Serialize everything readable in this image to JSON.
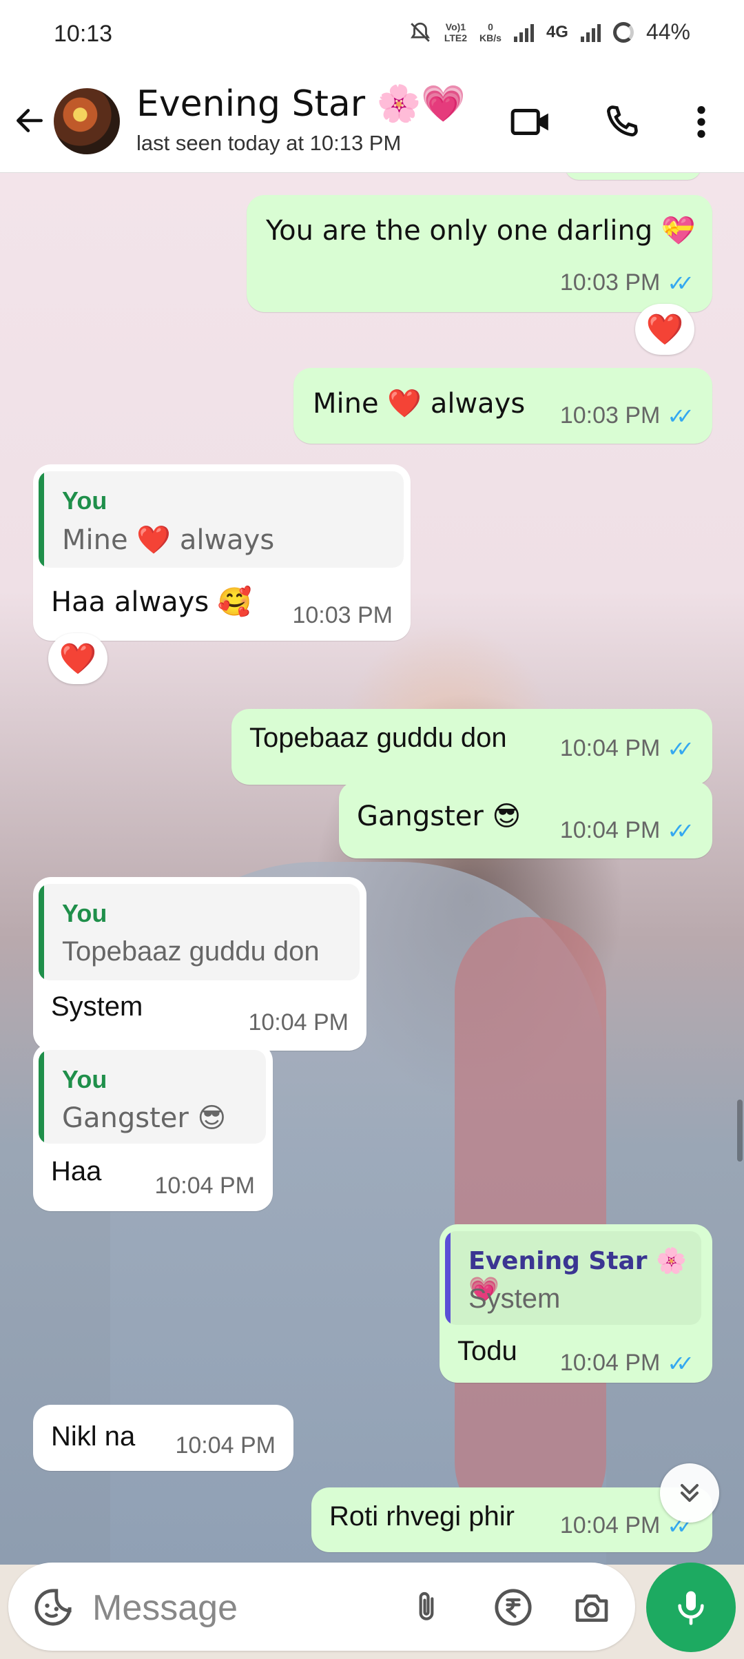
{
  "status_bar": {
    "time": "10:13",
    "volte": "Vo)1\nLTE2",
    "speed": "0\nKB/s",
    "network": "4G",
    "battery": "44%"
  },
  "header": {
    "contact_name": "Evening Star 🌸💗",
    "last_seen": "last seen today at 10:13 PM"
  },
  "messages": [
    {
      "text": "You are the only one darling 💝",
      "time": "10:03 PM",
      "reaction": "❤️"
    },
    {
      "text": "Mine ❤️ always",
      "time": "10:03 PM"
    },
    {
      "quote_author": "You",
      "quote_text": "Mine ❤️ always",
      "text": "Haa always 🥰",
      "time": "10:03 PM",
      "reaction": "❤️"
    },
    {
      "text": "Topebaaz guddu don",
      "time": "10:04 PM"
    },
    {
      "text": "Gangster 😎",
      "time": "10:04 PM"
    },
    {
      "quote_author": "You",
      "quote_text": "Topebaaz guddu don",
      "text": "System",
      "time": "10:04 PM"
    },
    {
      "quote_author": "You",
      "quote_text": "Gangster 😎",
      "text": "Haa",
      "time": "10:04 PM"
    },
    {
      "quote_author": "Evening Star 🌸💗",
      "quote_text": "System",
      "text": "Todu",
      "time": "10:04 PM"
    },
    {
      "text": "Nikl na",
      "time": "10:04 PM"
    },
    {
      "text": "Roti rhvegi phir",
      "time": "10:04 PM"
    }
  ],
  "composer": {
    "placeholder": "Message"
  },
  "colors": {
    "outgoing_bubble": "#d9fdd3",
    "incoming_bubble": "#ffffff",
    "read_ticks": "#34a8f0",
    "mic_button": "#1daa61",
    "quote_you": "#1f8f4a",
    "quote_contact": "#5b4fd6"
  }
}
